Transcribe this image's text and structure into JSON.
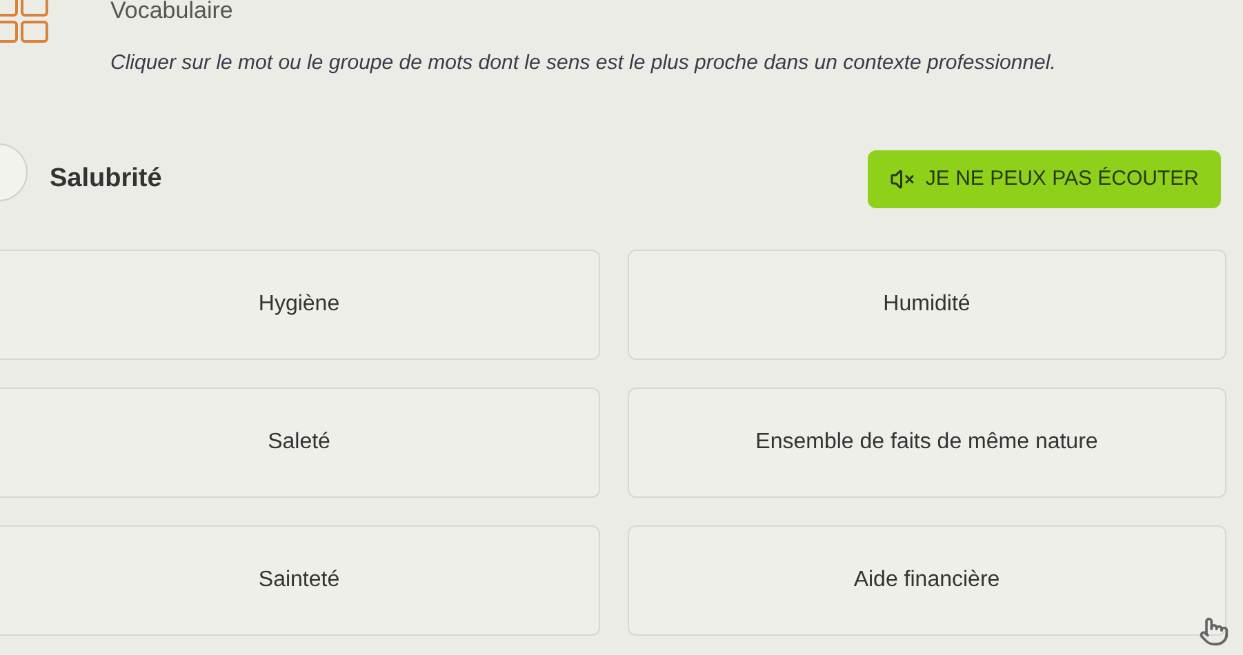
{
  "header": {
    "title": "Vocabulaire",
    "instruction": "Cliquer sur le mot ou le groupe de mots dont le sens est le plus proche dans un contexte professionnel."
  },
  "question": {
    "word": "Salubrité"
  },
  "listen_button": {
    "label": "JE NE PEUX PAS ÉCOUTER"
  },
  "options": [
    {
      "label": "Hygiène",
      "selected": false
    },
    {
      "label": "Humidité",
      "selected": false
    },
    {
      "label": "Saleté",
      "selected": false
    },
    {
      "label": "Ensemble de faits de même nature",
      "selected": false
    },
    {
      "label": "Sainteté",
      "selected": false
    },
    {
      "label": "Aide financière",
      "selected": false
    }
  ]
}
